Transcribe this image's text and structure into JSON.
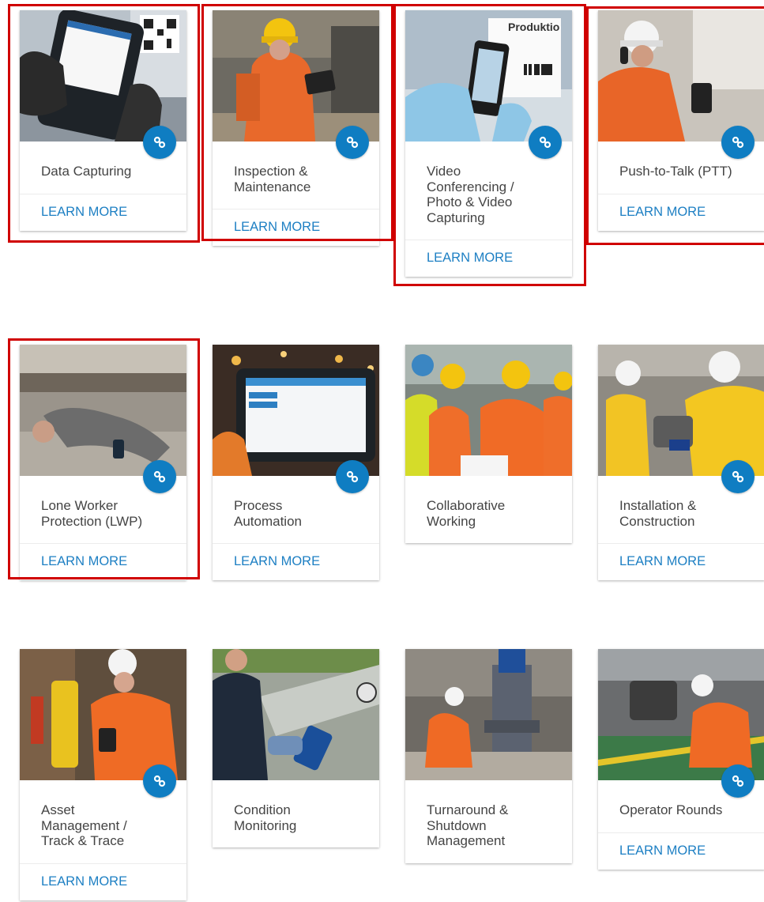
{
  "colors": {
    "accent": "#0f7dc2",
    "link": "#1d7fc3",
    "highlight": "#d00000",
    "title": "#444444"
  },
  "cards": [
    {
      "title": "Data Capturing",
      "link": "LEARN MORE",
      "icon": "link-icon",
      "highlighted": true
    },
    {
      "title": "Inspection & Maintenance",
      "link": "LEARN MORE",
      "icon": "link-icon",
      "highlighted": true
    },
    {
      "title": "Video Conferencing / Photo & Video Capturing",
      "link": "LEARN MORE",
      "icon": "link-icon",
      "highlighted": true,
      "image_text": "Produktio"
    },
    {
      "title": "Push-to-Talk (PTT)",
      "link": "LEARN MORE",
      "icon": "link-icon",
      "highlighted": true
    },
    {
      "title": "Lone Worker Protection (LWP)",
      "link": "LEARN MORE",
      "icon": "link-icon",
      "highlighted": true
    },
    {
      "title": "Process Automation",
      "link": "LEARN MORE",
      "icon": "link-icon",
      "highlighted": false
    },
    {
      "title": "Collaborative Working",
      "link": "",
      "icon": "",
      "highlighted": false
    },
    {
      "title": "Installation & Construction",
      "link": "LEARN MORE",
      "icon": "link-icon",
      "highlighted": false
    },
    {
      "title": "Asset Management / Track & Trace",
      "link": "LEARN MORE",
      "icon": "link-icon",
      "highlighted": false
    },
    {
      "title": "Condition Monitoring",
      "link": "",
      "icon": "",
      "highlighted": false
    },
    {
      "title": "Turnaround & Shutdown Management",
      "link": "",
      "icon": "",
      "highlighted": false
    },
    {
      "title": "Operator Rounds",
      "link": "LEARN MORE",
      "icon": "link-icon",
      "highlighted": false
    }
  ]
}
